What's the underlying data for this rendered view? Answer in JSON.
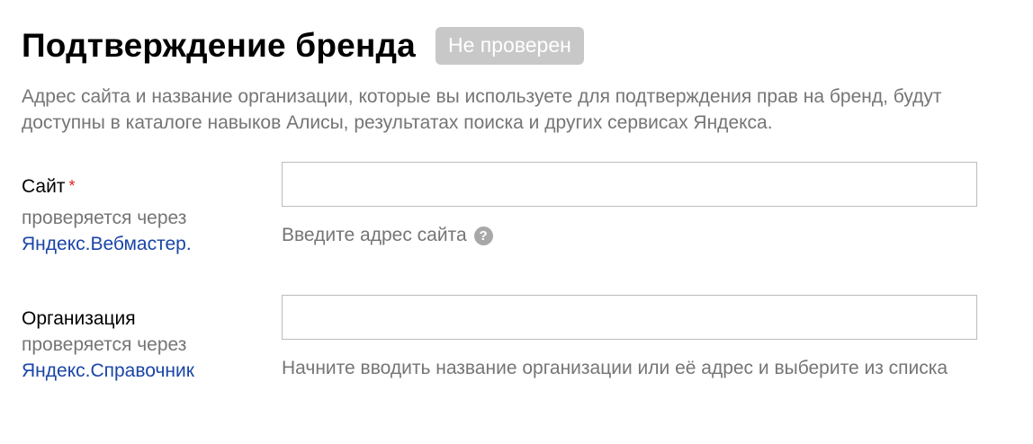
{
  "header": {
    "title": "Подтверждение бренда",
    "status": "Не проверен"
  },
  "description": "Адрес сайта и название организации, которые вы используете для подтверждения прав на бренд, будут доступны в каталоге навыков Алисы, результатах поиска и других сервисах Яндекса.",
  "site_field": {
    "label": "Сайт",
    "required_mark": "*",
    "verified_via": "проверяется через",
    "service_link": "Яндекс.Вебмастер.",
    "value": "",
    "hint": "Введите адрес сайта",
    "help_glyph": "?"
  },
  "org_field": {
    "label": "Организация",
    "verified_via": "проверяется через",
    "service_link": "Яндекс.Справочник",
    "value": "",
    "hint": "Начните вводить название организации или её адрес и выберите из списка"
  },
  "colors": {
    "required": "#e0231f",
    "link": "#1a45a8",
    "muted_text": "#757575",
    "badge_bg": "#c8c8c8",
    "input_border": "#bcbcbc"
  }
}
